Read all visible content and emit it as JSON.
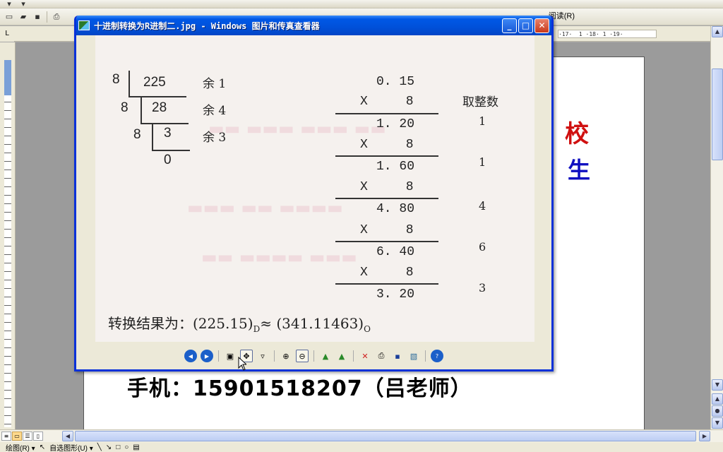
{
  "word": {
    "read_menu": "阅读(R)",
    "ruler_scale": "·17·  1 ·18· 1 ·19·",
    "doc_char_red": "校",
    "doc_char_blue": "生",
    "phone_line": "手机：15901518207（吕老师）",
    "drawing_label": "绘图(R) ▾",
    "autoshape_label": "自选图形(U) ▾"
  },
  "viewer": {
    "title": "十进制转换为R进制二.jpg - Windows 图片和传真查看器",
    "buttons": {
      "minimize": "_",
      "maximize": "□",
      "close": "✕"
    },
    "toolbar_icons": [
      "previous-image-icon",
      "next-image-icon",
      "best-fit-icon",
      "actual-size-icon",
      "slideshow-icon",
      "zoom-in-icon",
      "zoom-out-icon",
      "rotate-clockwise-icon",
      "rotate-counterclockwise-icon",
      "delete-icon",
      "print-icon",
      "save-icon",
      "open-editor-icon",
      "help-icon"
    ]
  },
  "image_content": {
    "integer_division": {
      "rows": [
        {
          "divisor": "8",
          "dividend": "225",
          "remainder": "余 1"
        },
        {
          "divisor": "8",
          "dividend": "28",
          "remainder": "余 4"
        },
        {
          "divisor": "8",
          "dividend": "3",
          "remainder": "余 3"
        }
      ],
      "final_quotient": "0"
    },
    "fraction_multiplication": {
      "header": "取整数",
      "start": "0. 15",
      "multiplier_row": "X     8",
      "products": [
        "1. 20",
        "1. 60",
        "4. 80",
        "6. 40",
        "3. 20"
      ],
      "integer_parts": [
        "1",
        "1",
        "4",
        "6",
        "3"
      ]
    },
    "result": {
      "prefix": "转换结果为：(225.15)",
      "sub_d": "D",
      "approx": "≈ (341.11463)",
      "sub_o": "O"
    }
  }
}
